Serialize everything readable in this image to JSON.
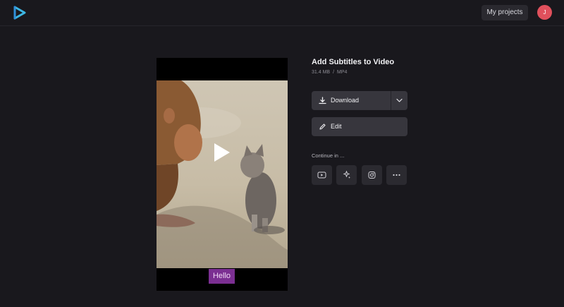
{
  "header": {
    "my_projects_label": "My projects",
    "avatar_initial": "J",
    "avatar_color": "#e0505c",
    "logo_icon": "play-triangle-logo-icon"
  },
  "video": {
    "subtitle_text": "Hello",
    "subtitle_bg": "#7b2f92",
    "play_icon": "play-icon"
  },
  "details": {
    "title": "Add Subtitles to Video",
    "size": "31.4 MB",
    "separator": "/",
    "format": "MP4"
  },
  "actions": {
    "download_label": "Download",
    "edit_label": "Edit"
  },
  "continue": {
    "label": "Continue in ...",
    "icons": [
      "youtube-icon",
      "sparkle-tools-icon",
      "instagram-icon",
      "more-options-icon"
    ]
  }
}
